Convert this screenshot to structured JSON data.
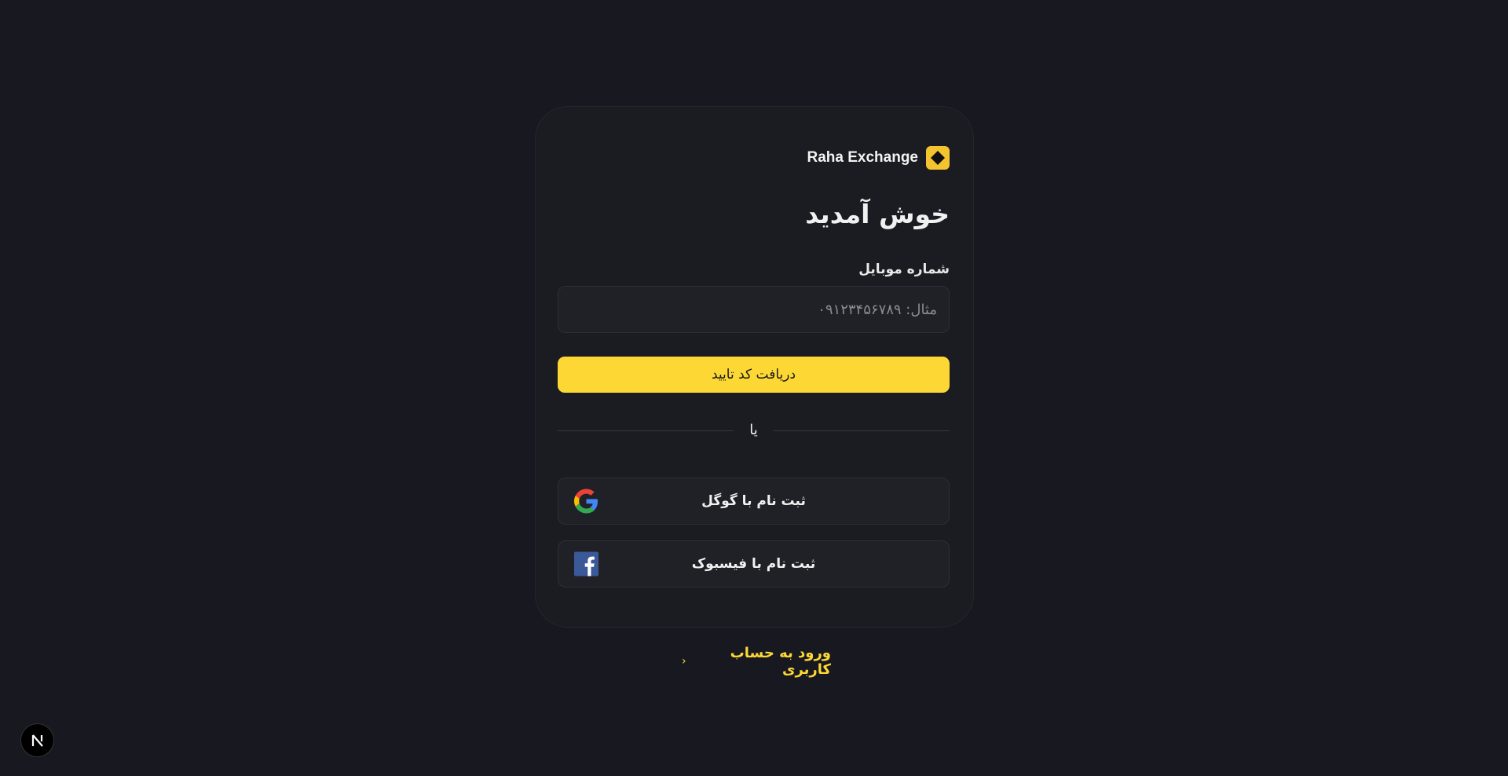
{
  "brand": {
    "name": "Raha Exchange",
    "accent_color": "#f4c430"
  },
  "form": {
    "title": "خوش آمدید",
    "phone_label": "شماره موبایل",
    "phone_placeholder": "مثال: ۰۹۱۲۳۴۵۶۷۸۹",
    "phone_value": "",
    "submit_label": "دریافت کد تایید",
    "divider_text": "یا"
  },
  "social": {
    "google_label": "ثبت نام با گوگل",
    "google_icon": "google-icon",
    "facebook_label": "ثبت نام با فیسبوک",
    "facebook_icon": "facebook-icon"
  },
  "footer": {
    "login_link": "ورود به حساب کاربری",
    "chevron": "‹"
  },
  "dev_badge": {
    "letter": "N"
  },
  "colors": {
    "background": "#181920",
    "card": "#1a1c22",
    "primary": "#fdd835"
  }
}
